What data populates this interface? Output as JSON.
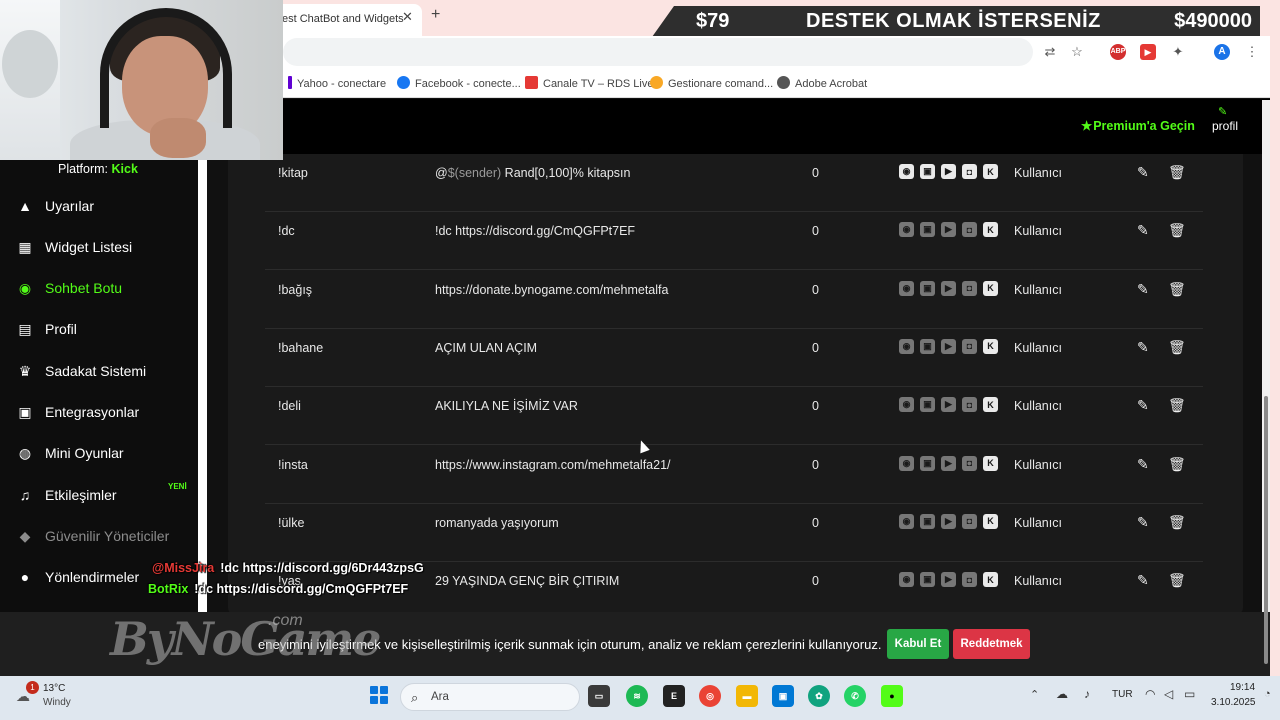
{
  "browser": {
    "active_tab_title": "est ChatBot and Widgets",
    "tab_close": "✕",
    "new_tab": "+",
    "bookmarks": [
      {
        "label": "Yahoo - conectare",
        "icon": "yahoo-icon",
        "color": "#6001d2"
      },
      {
        "label": "Facebook - conecte...",
        "icon": "facebook-icon",
        "color": "#1877f2"
      },
      {
        "label": "Canale TV – RDS Live",
        "icon": "tv-icon",
        "color": "#e53935"
      },
      {
        "label": "Gestionare comand...",
        "icon": "emoji-icon",
        "color": "#f9a825"
      },
      {
        "label": "Adobe Acrobat",
        "icon": "globe-icon",
        "color": "#555555"
      }
    ],
    "account_initial": "A",
    "abp_label": "ABP"
  },
  "donation_banner": {
    "left_amount": "$79",
    "title": "DESTEK OLMAK İSTERSENİZ",
    "right_amount": "$490000"
  },
  "sidebar": {
    "platform_label": "Platform:",
    "platform_value": "Kick",
    "items": [
      {
        "label": "Uyarılar",
        "icon": "warning-icon",
        "glyph": "▲",
        "state": "normal"
      },
      {
        "label": "Widget Listesi",
        "icon": "grid-icon",
        "glyph": "▦",
        "state": "normal"
      },
      {
        "label": "Sohbet Botu",
        "icon": "robot-icon",
        "glyph": "◉",
        "state": "active"
      },
      {
        "label": "Profil",
        "icon": "id-card-icon",
        "glyph": "▤",
        "state": "normal"
      },
      {
        "label": "Sadakat Sistemi",
        "icon": "trophy-icon",
        "glyph": "♛",
        "state": "normal"
      },
      {
        "label": "Entegrasyonlar",
        "icon": "integration-icon",
        "glyph": "▣",
        "state": "normal"
      },
      {
        "label": "Mini Oyunlar",
        "icon": "gamepad-icon",
        "glyph": "◍",
        "state": "normal"
      },
      {
        "label": "Etkileşimler",
        "icon": "music-icon",
        "glyph": "♫",
        "state": "normal"
      },
      {
        "label": "Güvenilir Yöneticiler",
        "icon": "shield-icon",
        "glyph": "◆",
        "state": "disabled"
      },
      {
        "label": "Yönlendirmeler",
        "icon": "users-icon",
        "glyph": "●",
        "state": "normal"
      }
    ],
    "new_badge": "YENİ"
  },
  "topbar": {
    "premium_label": "Premium'a Geçin",
    "profile_label": "profil"
  },
  "commands": [
    {
      "command": "!kitap",
      "response_prefix": "@",
      "response_muted": "$(sender)",
      "response_rest": " Rand[0,100]% kitapsın",
      "count": "0",
      "platforms_on": [
        true,
        true,
        true,
        true,
        true
      ],
      "role": "Kullanıcı"
    },
    {
      "command": "!dc",
      "response_prefix": "",
      "response_muted": "",
      "response_rest": "!dc https://discord.gg/CmQGFPt7EF",
      "count": "0",
      "platforms_on": [
        false,
        false,
        false,
        false,
        true
      ],
      "role": "Kullanıcı"
    },
    {
      "command": "!bağış",
      "response_prefix": "",
      "response_muted": "",
      "response_rest": "https://donate.bynogame.com/mehmetalfa",
      "count": "0",
      "platforms_on": [
        false,
        false,
        false,
        false,
        true
      ],
      "role": "Kullanıcı"
    },
    {
      "command": "!bahane",
      "response_prefix": "",
      "response_muted": "",
      "response_rest": "AÇIM ULAN AÇIM",
      "count": "0",
      "platforms_on": [
        false,
        false,
        false,
        false,
        true
      ],
      "role": "Kullanıcı"
    },
    {
      "command": "!deli",
      "response_prefix": "",
      "response_muted": "",
      "response_rest": "AKILIYLA NE İŞİMİZ VAR",
      "count": "0",
      "platforms_on": [
        false,
        false,
        false,
        false,
        true
      ],
      "role": "Kullanıcı"
    },
    {
      "command": "!insta",
      "response_prefix": "",
      "response_muted": "",
      "response_rest": "https://www.instagram.com/mehmetalfa21/",
      "count": "0",
      "platforms_on": [
        false,
        false,
        false,
        false,
        true
      ],
      "role": "Kullanıcı"
    },
    {
      "command": "!ülke",
      "response_prefix": "",
      "response_muted": "",
      "response_rest": "romanyada yaşıyorum",
      "count": "0",
      "platforms_on": [
        false,
        false,
        false,
        false,
        true
      ],
      "role": "Kullanıcı"
    },
    {
      "command": "!yaş",
      "response_prefix": "",
      "response_muted": "",
      "response_rest": "29 YAŞINDA GENÇ BİR ÇITIRIM",
      "count": "0",
      "platforms_on": [
        false,
        false,
        false,
        false,
        true
      ],
      "role": "Kullanıcı"
    }
  ],
  "platform_icons": [
    "kick-bot-icon",
    "twitch-icon",
    "youtube-icon",
    "discord-icon",
    "kick-icon"
  ],
  "chat_overlay": [
    {
      "user": "@MissJira",
      "user_color": "#e53935",
      "message": "!dc https://discord.gg/6Dr443zpsG"
    },
    {
      "user": "BotRix",
      "user_color": "#53fc18",
      "message": "!dc https://discord.gg/CmQGFPt7EF"
    }
  ],
  "cookie_bar": {
    "text": "eneyimini iyileştirmek ve kişiselleştirilmiş içerik sunmak için oturum, analiz ve reklam çerezlerini kullanıyoruz.",
    "accept_label": "Kabul Et",
    "reject_label": "Reddetmek",
    "logo": "ByNoGame",
    "logo_suffix": ".com"
  },
  "taskbar": {
    "weather_temp": "13°C",
    "weather_cond": "Windy",
    "weather_badge": "1",
    "search_label": "Ara",
    "lang": "TUR",
    "time": "19:14",
    "date": "3.10.2025"
  },
  "colors": {
    "accent": "#53fc18",
    "accept": "#28a745",
    "reject": "#dc3545"
  }
}
